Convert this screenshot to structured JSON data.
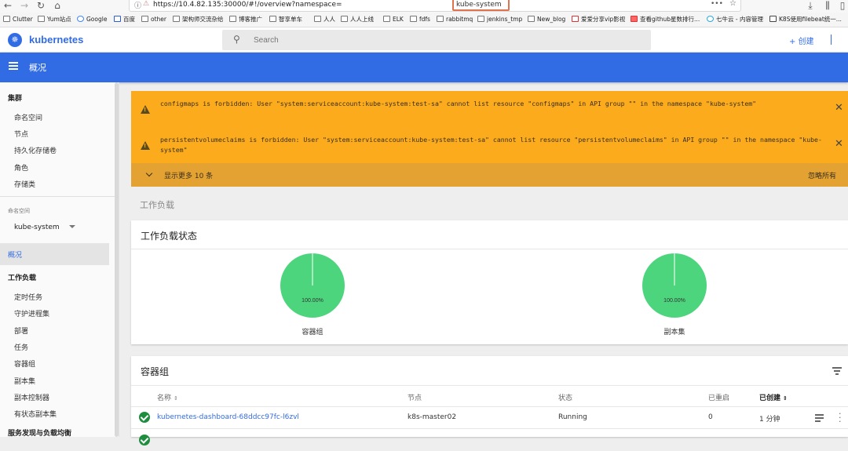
{
  "browser": {
    "back": "←",
    "forward": "→",
    "reload": "↻",
    "home": "⌂",
    "url": "https://10.4.82.135:30000/#!/overview?namespace=",
    "url_namespace": "kube-system",
    "menu_dots": "•••",
    "bookmarks": [
      "Clutter",
      "Yum站点",
      "Google",
      "百度",
      "other",
      "架构师交流杂给",
      "博客推广",
      "智享单车",
      "人人",
      "人人上线",
      "ELK",
      "fdfs",
      "rabbitmq",
      "jenkins_tmp",
      "New_blog",
      "爱爱分享vip影视",
      "查看github星数排行...",
      "七牛云 - 内容管理",
      "K8S使用filebeat统一..."
    ]
  },
  "header": {
    "brand": "kubernetes",
    "search_placeholder": "Search",
    "create_label": "+ 创建"
  },
  "titlebar": {
    "title": "概况"
  },
  "sidebar": {
    "cluster_heading": "集群",
    "cluster_items": [
      "命名空间",
      "节点",
      "持久化存储卷",
      "角色",
      "存储类"
    ],
    "namespace_label": "命名空间",
    "namespace_value": "kube-system",
    "overview": "概况",
    "workloads_heading": "工作负载",
    "workload_items": [
      "定时任务",
      "守护进程集",
      "部署",
      "任务",
      "容器组",
      "副本集",
      "副本控制器",
      "有状态副本集"
    ],
    "discovery_heading": "服务发现与负载均衡"
  },
  "alerts": {
    "items": [
      {
        "text": "configmaps is forbidden: User \"system:serviceaccount:kube-system:test-sa\" cannot list resource \"configmaps\" in API group \"\" in the namespace \"kube-system\""
      },
      {
        "text": "persistentvolumeclaims is forbidden: User \"system:serviceaccount:kube-system:test-sa\" cannot list resource \"persistentvolumeclaims\" in API group \"\" in the namespace \"kube-system\""
      }
    ],
    "show_more": "显示更多 10 条",
    "ignore_all": "忽略所有"
  },
  "workloads_section": "工作负载",
  "workload_status": {
    "title": "工作负载状态",
    "pies": [
      {
        "caption": "容器组",
        "percent_label": "100.00%",
        "value": 1.0,
        "color": "#4cd57d"
      },
      {
        "caption": "副本集",
        "percent_label": "100.00%",
        "value": 1.0,
        "color": "#4cd57d"
      }
    ]
  },
  "pods": {
    "title": "容器组",
    "columns": [
      "名称",
      "节点",
      "状态",
      "已重启",
      "已创建"
    ],
    "sort_arrows": "⇕",
    "rows": [
      {
        "name": "kubernetes-dashboard-68ddcc97fc-l6zvl",
        "node": "k8s-master02",
        "status": "Running",
        "restarts": "0",
        "created": "1 分钟"
      }
    ]
  }
}
